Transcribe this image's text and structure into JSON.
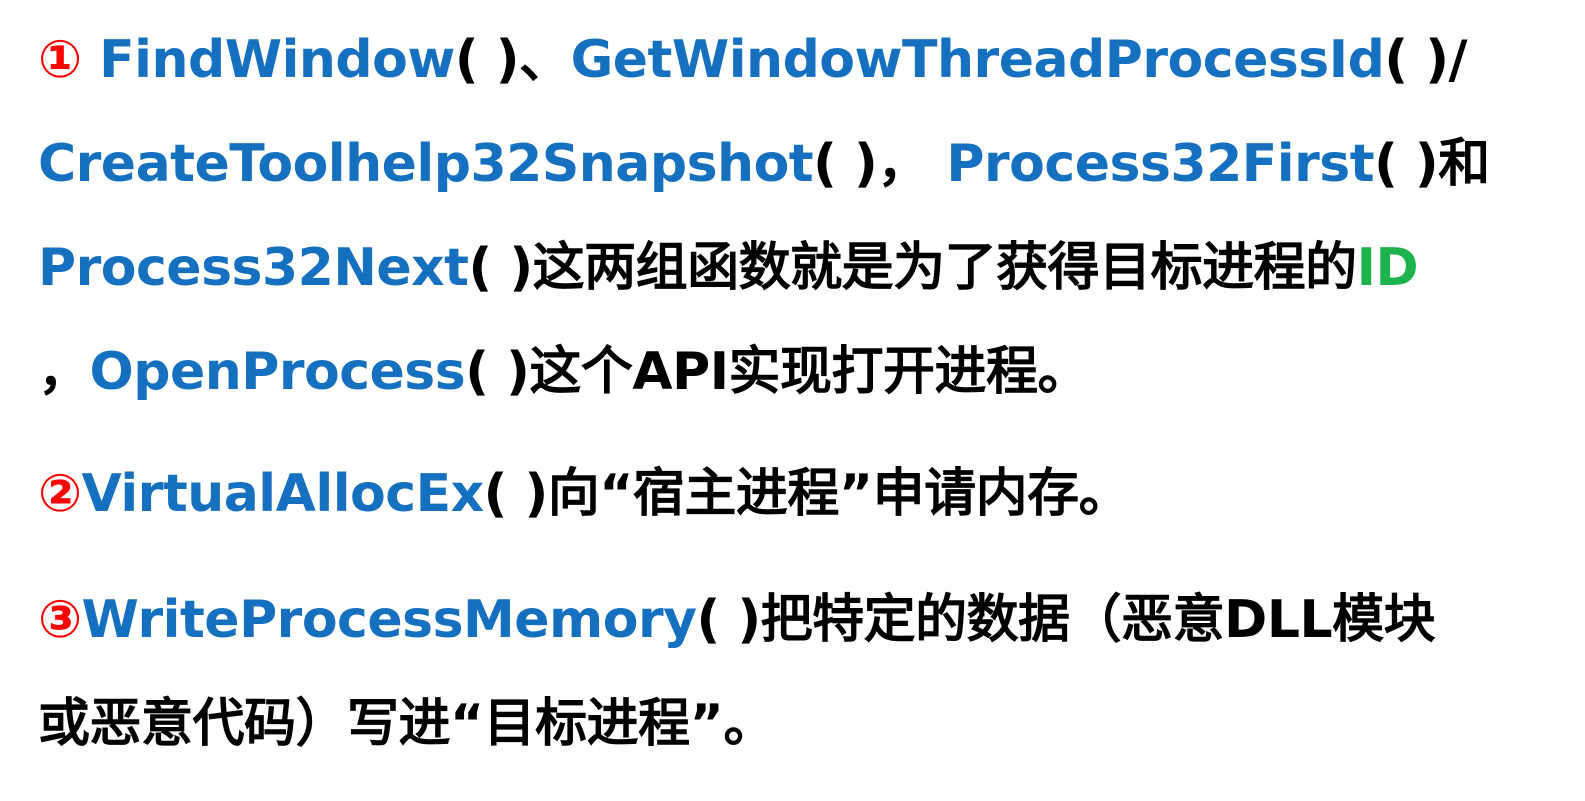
{
  "colors": {
    "api_blue": "#1570c0",
    "marker_red": "#ff0000",
    "id_green": "#1db34d",
    "text_black": "#000000"
  },
  "items": [
    {
      "marker": "①",
      "lines": [
        [
          {
            "text": " FindWindow",
            "color": "blue"
          },
          {
            "text": "( )、",
            "color": "black"
          },
          {
            "text": "GetWindowThreadProcessId",
            "color": "blue"
          },
          {
            "text": "( )/",
            "color": "black"
          }
        ],
        [
          {
            "text": "CreateToolhelp32Snapshot",
            "color": "blue"
          },
          {
            "text": "(  )， ",
            "color": "black"
          },
          {
            "text": "Process32First",
            "color": "blue"
          },
          {
            "text": "(  )和",
            "color": "black"
          }
        ],
        [
          {
            "text": "Process32Next",
            "color": "blue"
          },
          {
            "text": "(  )这两组函数就是为了获得目标进程的",
            "color": "black"
          },
          {
            "text": "ID",
            "color": "green"
          }
        ],
        [
          {
            "text": "，",
            "color": "black"
          },
          {
            "text": "OpenProcess",
            "color": "blue"
          },
          {
            "text": "( )这个API实现打开进程。",
            "color": "black"
          }
        ]
      ]
    },
    {
      "marker": "②",
      "lines": [
        [
          {
            "text": "VirtualAllocEx",
            "color": "blue"
          },
          {
            "text": "( )向“宿主进程”申请内存。",
            "color": "black"
          }
        ]
      ]
    },
    {
      "marker": "③",
      "lines": [
        [
          {
            "text": "WriteProcessMemory",
            "color": "blue"
          },
          {
            "text": "( )把特定的数据（恶意DLL模块",
            "color": "black"
          }
        ],
        [
          {
            "text": "或恶意代码）写进“目标进程”。",
            "color": "black"
          }
        ]
      ]
    }
  ]
}
